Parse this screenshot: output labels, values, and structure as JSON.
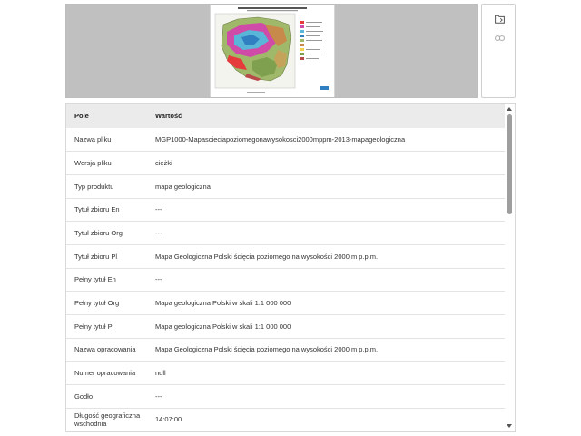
{
  "table": {
    "headers": {
      "field": "Pole",
      "value": "Wartość"
    },
    "rows": [
      {
        "field": "Nazwa pliku",
        "value": "MGP1000-Mapascieciapoziomegonawysokosci2000mppm-2013-mapageologiczna"
      },
      {
        "field": "Wersja pliku",
        "value": "ciężki"
      },
      {
        "field": "Typ produktu",
        "value": "mapa geologiczna"
      },
      {
        "field": "Tytuł zbioru En",
        "value": "---"
      },
      {
        "field": "Tytuł zbioru Org",
        "value": "---"
      },
      {
        "field": "Tytuł zbioru Pl",
        "value": "Mapa Geologiczna Polski ścięcia poziomego na wysokości 2000 m p.p.m."
      },
      {
        "field": "Pełny tytuł En",
        "value": "---"
      },
      {
        "field": "Pełny tytuł Org",
        "value": "Mapa geologiczna Polski w skali 1:1 000 000"
      },
      {
        "field": "Pełny tytuł Pl",
        "value": "Mapa geologiczna Polski w skali 1:1 000 000"
      },
      {
        "field": "Nazwa opracowania",
        "value": "Mapa Geologiczna Polski ścięcia poziomego na wysokości 2000 m p.p.m."
      },
      {
        "field": "Numer opracowania",
        "value": "null"
      },
      {
        "field": "Godło",
        "value": "---"
      },
      {
        "field": "Długość geograficzna wschodnia",
        "value": "14:07:00"
      }
    ]
  },
  "icons": {
    "folder": "folder-icon",
    "link": "link-icon"
  },
  "colors": {
    "preview_bg": "#c0c0c0",
    "header_bg": "#ebebeb",
    "row_border": "#e3e3e3"
  }
}
